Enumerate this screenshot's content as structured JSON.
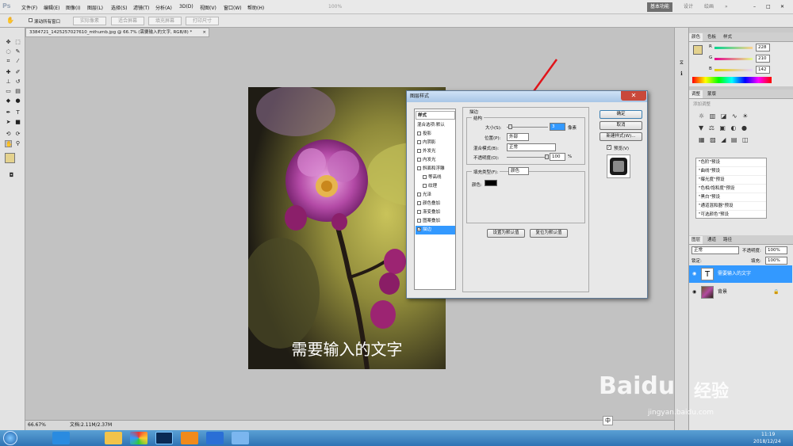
{
  "app": {
    "logo": "Ps"
  },
  "menu": [
    "文件(F)",
    "编辑(E)",
    "图像(I)",
    "图层(L)",
    "选择(S)",
    "滤镜(T)",
    "分析(A)",
    "3D(D)",
    "视图(V)",
    "窗口(W)",
    "帮助(H)"
  ],
  "zoom_menu": "100%",
  "workspace": {
    "active": "基本功能",
    "items": [
      "设计",
      "绘画",
      "»"
    ]
  },
  "window_buttons": [
    "–",
    "□",
    "✕"
  ],
  "options_bar": {
    "checkbox_label": "滚动所有窗口",
    "buttons": [
      "实际像素",
      "适合屏幕",
      "填充屏幕",
      "打印尺寸"
    ]
  },
  "document_tab": {
    "title": "3384721_1425257027610_mthumb.jpg @ 66.7% (需要输入的文字, RGB/8) *",
    "close": "×"
  },
  "canvas_text": "需要输入的文字",
  "status": {
    "zoom": "66.67%",
    "doc_size": "文档:2.11M/2.37M"
  },
  "color_panel": {
    "tabs": [
      "颜色",
      "色板",
      "样式"
    ],
    "channels": [
      {
        "label": "R",
        "value": "228"
      },
      {
        "label": "G",
        "value": "210"
      },
      {
        "label": "B",
        "value": "142"
      }
    ],
    "foreground": "#e4d28e"
  },
  "adjust_panel": {
    "tabs": [
      "调整",
      "蒙版"
    ],
    "hint": "添加调整",
    "presets": [
      "\"色阶\"预设",
      "\"曲线\"预设",
      "\"曝光度\"预设",
      "\"色相/饱和度\"预设",
      "\"黑白\"预设",
      "\"通道混和器\"预设",
      "\"可选颜色\"预设"
    ]
  },
  "layers_panel": {
    "tabs": [
      "图层",
      "通道",
      "路径"
    ],
    "blend": "正常",
    "opacity_label": "不透明度:",
    "opacity": "100%",
    "lock_label": "锁定:",
    "fill_label": "填充:",
    "fill": "100%",
    "layers": [
      {
        "name": "需要输入的文字",
        "type": "T",
        "selected": true
      },
      {
        "name": "背景",
        "type": "image",
        "selected": false
      }
    ]
  },
  "dialog": {
    "title": "图层样式",
    "close": "✕",
    "list_header": "样式",
    "list_blend": "混合选项:默认",
    "styles": [
      {
        "label": "投影",
        "checked": false
      },
      {
        "label": "内阴影",
        "checked": false
      },
      {
        "label": "外发光",
        "checked": false
      },
      {
        "label": "内发光",
        "checked": false
      },
      {
        "label": "斜面和浮雕",
        "checked": false
      },
      {
        "label": "等高线",
        "checked": false,
        "sub": true
      },
      {
        "label": "纹理",
        "checked": false,
        "sub": true
      },
      {
        "label": "光泽",
        "checked": false
      },
      {
        "label": "颜色叠加",
        "checked": false
      },
      {
        "label": "渐变叠加",
        "checked": false
      },
      {
        "label": "图案叠加",
        "checked": false
      },
      {
        "label": "描边",
        "checked": true,
        "selected": true
      }
    ],
    "section_title": "描边",
    "group_title": "结构",
    "size_label": "大小(S):",
    "size_value": "3",
    "size_unit": "像素",
    "position_label": "位置(P):",
    "position_value": "外部",
    "blend_label": "混合模式(B):",
    "blend_value": "正常",
    "opacity_label": "不透明度(O):",
    "opacity_value": "100",
    "opacity_unit": "%",
    "fill_type_label": "填充类型(F):",
    "fill_type_value": "颜色",
    "color_label": "颜色:",
    "stroke_color": "#000000",
    "set_default": "设置为默认值",
    "reset_default": "复位为默认值",
    "ok": "确定",
    "cancel": "取消",
    "new_style": "新建样式(W)...",
    "preview": "预览(V)",
    "preview_checked": true
  },
  "taskbar": {
    "time": "11:19",
    "date": "2018/12/24",
    "ime": "中"
  },
  "watermark": {
    "brand": "Baidu",
    "cn": "经验",
    "url": "jingyan.baidu.com"
  },
  "colors": {
    "accent": "#3399ff",
    "arrow": "#e0141a",
    "taskbar": "#3a86c8"
  }
}
